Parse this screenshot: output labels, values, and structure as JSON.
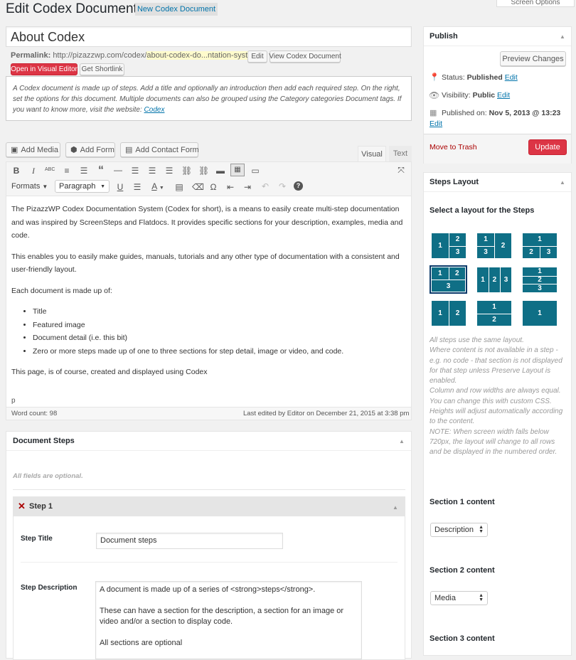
{
  "header": {
    "title": "Edit Codex Document",
    "new_button": "New Codex Document",
    "screen_options": "Screen Options"
  },
  "post": {
    "title": "About Codex",
    "permalink_label": "Permalink:",
    "permalink_base": "http://pizazzwp.com/codex/",
    "permalink_slug": "about-codex-do...ntation-system",
    "permalink_end": "/",
    "edit_btn": "Edit",
    "view_btn": "View Codex Document",
    "visual_editor_btn": "Open in Visual Editor",
    "shortlink_btn": "Get Shortlink",
    "intro": "A Codex document is made up of steps. Add a title and optionally an introduction then add each required step. On the right, set the options for this document. Multiple documents can also be grouped using the Category categories Document tags. If you want to know more, visit the website:",
    "intro_link": "Codex"
  },
  "editor": {
    "add_media": "Add Media",
    "add_form": "Add Form",
    "add_contact_form": "Add Contact Form",
    "tab_visual": "Visual",
    "tab_text": "Text",
    "formats": "Formats",
    "paragraph": "Paragraph",
    "p1": "The PizazzWP Codex Documentation System (Codex for short), is a means to easily create multi-step documentation and was inspired by ScreenSteps and Flatdocs. It provides specific sections for your description, examples, media and code.",
    "p2": "This enables you to easily make guides, manuals, tutorials and any other type of documentation with a consistent and user-friendly layout.",
    "p3": "Each document is made up of:",
    "list": [
      "Title",
      "Featured image",
      "Document detail (i.e. this bit)",
      "Zero or more steps made up of one to three sections for step detail, image or video, and code."
    ],
    "p4": "This page, is of course, created and displayed using Codex",
    "path": "p",
    "word_count": "Word count: 98",
    "last_edited": "Last edited by Editor on December 21, 2015 at 3:38 pm"
  },
  "steps": {
    "title": "Document Steps",
    "optional": "All fields are optional.",
    "step1_label": "Step 1",
    "step_title_label": "Step Title",
    "step_title_value": "Document steps",
    "step_desc_label": "Step Description",
    "step_desc_l1": "A document is made up of a series of <strong>steps</strong>.",
    "step_desc_l2": "These can have a section for the description, a section for an image or video and/or a section to display code.",
    "step_desc_l3": "All sections are optional"
  },
  "publish": {
    "title": "Publish",
    "preview": "Preview Changes",
    "status_label": "Status:",
    "status_value": "Published",
    "visibility_label": "Visibility:",
    "visibility_value": "Public",
    "published_label": "Published on:",
    "published_value": "Nov 5, 2013 @ 13:23",
    "edit": "Edit",
    "trash": "Move to Trash",
    "update": "Update"
  },
  "layout_box": {
    "title": "Steps Layout",
    "subtitle": "Select a layout for the Steps",
    "note": "All steps use the same layout.\nWhere content is not available in a step - e.g. no code - that section is not displayed for that step unless Preserve Layout is enabled.\nColumn and row widths are always equal. You can change this with custom CSS. Heights will adjust automatically according to the content.\nNOTE: When screen width falls below 720px, the layout will change to all rows and be displayed in the numbered order.",
    "section1_label": "Section 1 content",
    "section1_value": "Description",
    "section2_label": "Section 2 content",
    "section2_value": "Media",
    "section3_label": "Section 3 content"
  },
  "colors": {
    "accent": "#0f6f86",
    "danger": "#dc3545",
    "link": "#0073aa"
  }
}
